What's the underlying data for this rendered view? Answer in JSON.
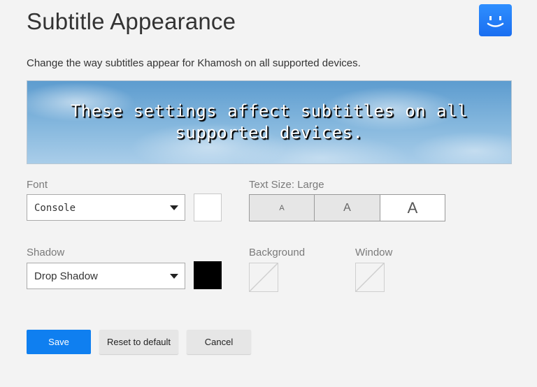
{
  "header": {
    "title": "Subtitle Appearance",
    "profile_icon": "smiley-profile-icon",
    "profile_color": "#1f78f0"
  },
  "description": "Change the way subtitles appear for Khamosh on all supported devices.",
  "preview": {
    "text": "These settings affect subtitles on all supported devices."
  },
  "font": {
    "label": "Font",
    "value": "Console",
    "color": "#ffffff"
  },
  "text_size": {
    "label": "Text Size: Large",
    "options": [
      "A",
      "A",
      "A"
    ],
    "selected": "Large"
  },
  "shadow": {
    "label": "Shadow",
    "value": "Drop Shadow",
    "color": "#000000"
  },
  "background": {
    "label": "Background",
    "color": "none"
  },
  "window": {
    "label": "Window",
    "color": "none"
  },
  "buttons": {
    "save": "Save",
    "reset": "Reset to default",
    "cancel": "Cancel"
  },
  "colors": {
    "primary": "#0f7ff0",
    "page_bg": "#f3f3f3"
  }
}
